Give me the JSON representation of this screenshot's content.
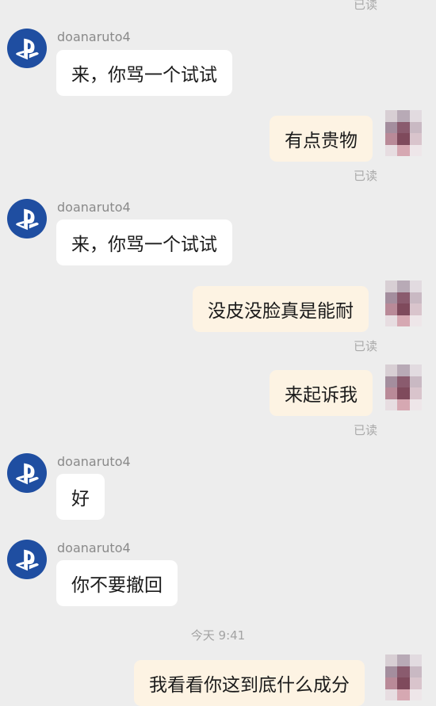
{
  "read_label": "已读",
  "contact_name": "doanaruto4",
  "colors": {
    "incoming_bubble": "#ffffff",
    "outgoing_bubble": "#fdf3e3",
    "avatar_blue": "#1f4ea1",
    "background": "#ededed"
  },
  "messages": [
    {
      "text": "来，你骂一个试试"
    },
    {
      "text": "有点贵物"
    },
    {
      "text": "来，你骂一个试试"
    },
    {
      "text": "没皮没脸真是能耐"
    },
    {
      "text": "来起诉我"
    },
    {
      "text": "好"
    },
    {
      "text": "你不要撤回"
    },
    {
      "text": "我看看你这到底什么成分"
    }
  ],
  "timestamp": "今天 9:41",
  "icons": {
    "contact_avatar": "playstation-logo-icon",
    "my_avatar": "pixelated-avatar"
  }
}
